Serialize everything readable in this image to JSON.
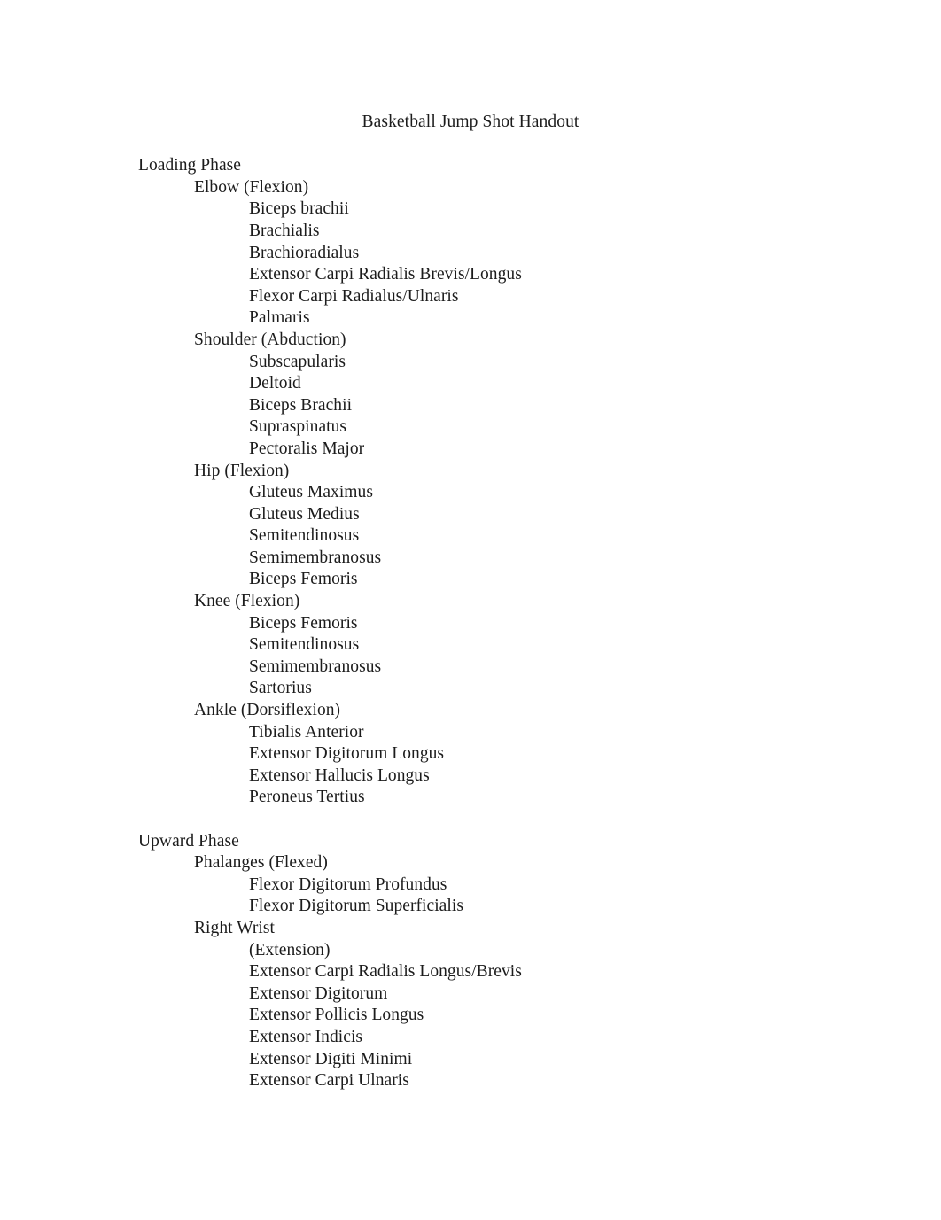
{
  "document": {
    "title": "Basketball Jump Shot Handout",
    "sections": [
      {
        "name": "Loading Phase",
        "groups": [
          {
            "joint": "Elbow (Flexion)",
            "muscles": [
              "Biceps brachii",
              "Brachialis",
              "Brachioradialus",
              "Extensor Carpi Radialis Brevis/Longus",
              "Flexor Carpi Radialus/Ulnaris",
              "Palmaris"
            ]
          },
          {
            "joint": "Shoulder (Abduction)",
            "muscles": [
              "Subscapularis",
              "Deltoid",
              "Biceps Brachii",
              "Supraspinatus",
              "Pectoralis Major"
            ]
          },
          {
            "joint": "Hip (Flexion)",
            "muscles": [
              "Gluteus Maximus",
              "Gluteus Medius",
              "Semitendinosus",
              "Semimembranosus",
              "Biceps Femoris"
            ]
          },
          {
            "joint": "Knee (Flexion)",
            "muscles": [
              "Biceps Femoris",
              "Semitendinosus",
              "Semimembranosus",
              "Sartorius"
            ]
          },
          {
            "joint": "Ankle (Dorsiflexion)",
            "muscles": [
              "Tibialis Anterior",
              "Extensor Digitorum Longus",
              "Extensor Hallucis Longus",
              "Peroneus Tertius"
            ]
          }
        ]
      },
      {
        "name": "Upward Phase",
        "groups": [
          {
            "joint": "Phalanges (Flexed)",
            "muscles": [
              "Flexor Digitorum Profundus",
              "Flexor Digitorum Superficialis"
            ]
          },
          {
            "joint": "Right Wrist",
            "muscles": [
              "(Extension)",
              "Extensor Carpi Radialis Longus/Brevis",
              "Extensor Digitorum",
              "Extensor Pollicis Longus",
              "Extensor Indicis",
              "Extensor Digiti Minimi",
              "Extensor Carpi Ulnaris"
            ]
          }
        ]
      }
    ]
  }
}
